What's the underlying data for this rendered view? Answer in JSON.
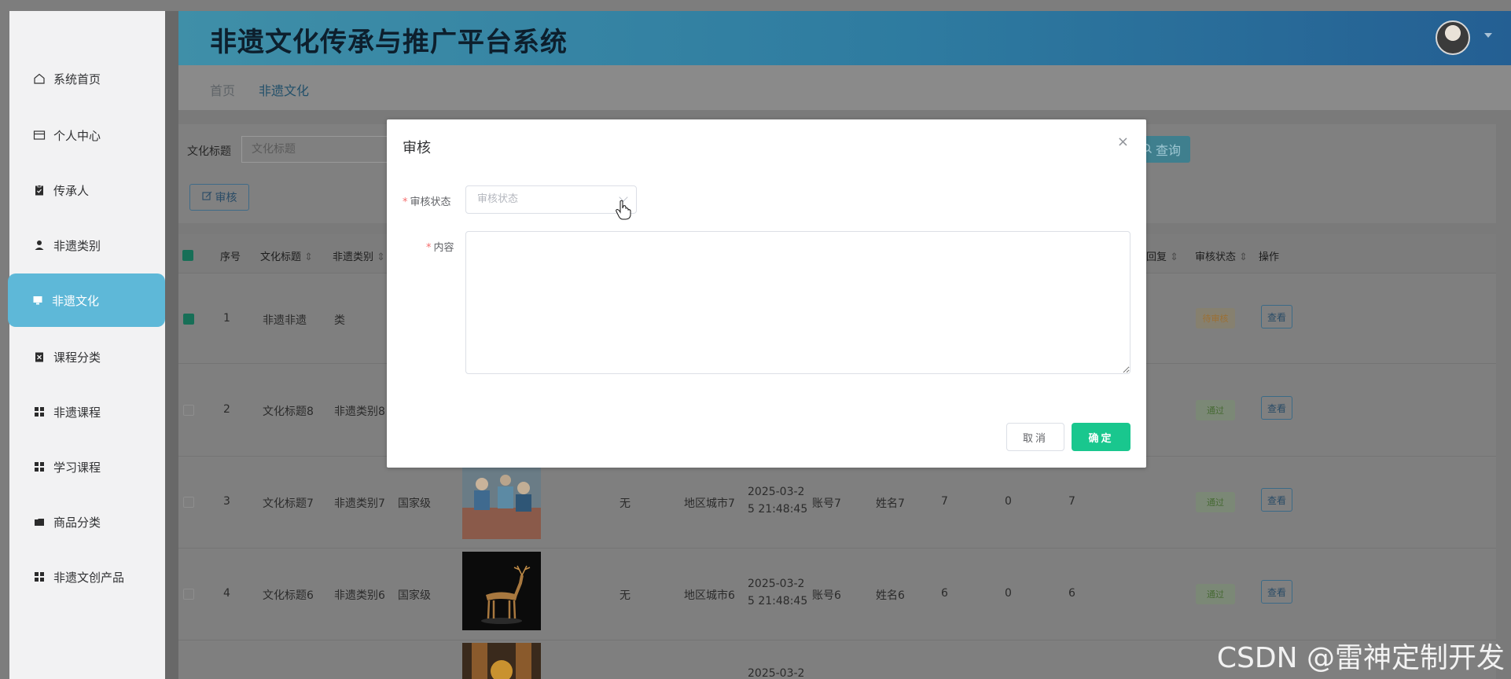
{
  "app": {
    "title": "非遗文化传承与推广平台系统"
  },
  "sidebar": {
    "items": [
      {
        "label": "系统首页",
        "icon": "home-icon"
      },
      {
        "label": "个人中心",
        "icon": "id-card-icon"
      },
      {
        "label": "传承人",
        "icon": "clipboard-icon"
      },
      {
        "label": "非遗类别",
        "icon": "user-icon"
      },
      {
        "label": "非遗文化",
        "icon": "monitor-icon",
        "active": true
      },
      {
        "label": "课程分类",
        "icon": "clipboard-check-icon"
      },
      {
        "label": "非遗课程",
        "icon": "grid-icon"
      },
      {
        "label": "学习课程",
        "icon": "grid-icon"
      },
      {
        "label": "商品分类",
        "icon": "folder-icon"
      },
      {
        "label": "非遗文创产品",
        "icon": "grid-icon"
      }
    ]
  },
  "breadcrumb": {
    "home": "首页",
    "current": "非遗文化"
  },
  "search": {
    "label": "文化标题",
    "placeholder": "文化标题",
    "button_label": "查询"
  },
  "toolbar": {
    "audit_label": "审核"
  },
  "table": {
    "headers": [
      "序号",
      "文化标题",
      "非遗类别",
      "回复",
      "审核状态",
      "操作"
    ],
    "rows": [
      {
        "index": "1",
        "title": "非遗非遗",
        "category": "类",
        "level": "",
        "status": "待审核",
        "status_type": "pending",
        "action": "查看",
        "checked": true,
        "extra": null
      },
      {
        "index": "2",
        "title": "文化标题8",
        "category": "非遗类别8",
        "level": "",
        "status": "通过",
        "status_type": "pass",
        "action": "查看",
        "checked": false,
        "extra": null
      },
      {
        "index": "3",
        "title": "文化标题7",
        "category": "非遗类别7",
        "level": "国家级",
        "status": "通过",
        "status_type": "pass",
        "action": "查看",
        "checked": false,
        "extra": {
          "none": "无",
          "region": "地区城市7",
          "date_line1": "2025-03-2",
          "date_line2": "5 21:48:45",
          "account": "账号7",
          "name": "姓名7",
          "n1": "7",
          "n2": "0",
          "n3": "7"
        }
      },
      {
        "index": "4",
        "title": "文化标题6",
        "category": "非遗类别6",
        "level": "国家级",
        "status": "通过",
        "status_type": "pass",
        "action": "查看",
        "checked": false,
        "extra": {
          "none": "无",
          "region": "地区城市6",
          "date_line1": "2025-03-2",
          "date_line2": "5 21:48:45",
          "account": "账号6",
          "name": "姓名6",
          "n1": "6",
          "n2": "0",
          "n3": "6"
        }
      }
    ],
    "partial_row_date": "2025-03-2"
  },
  "modal": {
    "title": "审核",
    "close": "×",
    "status_label": "审核状态",
    "status_placeholder": "审核状态",
    "content_label": "内容",
    "cancel_label": "取消",
    "ok_label": "确定"
  },
  "watermark": "CSDN @雷神定制开发",
  "colors": {
    "accent": "#19c78e",
    "header_start": "#3f8fa8",
    "header_end": "#245f93",
    "sidebar_active": "#5eb8d8",
    "required": "#f56c6c"
  }
}
